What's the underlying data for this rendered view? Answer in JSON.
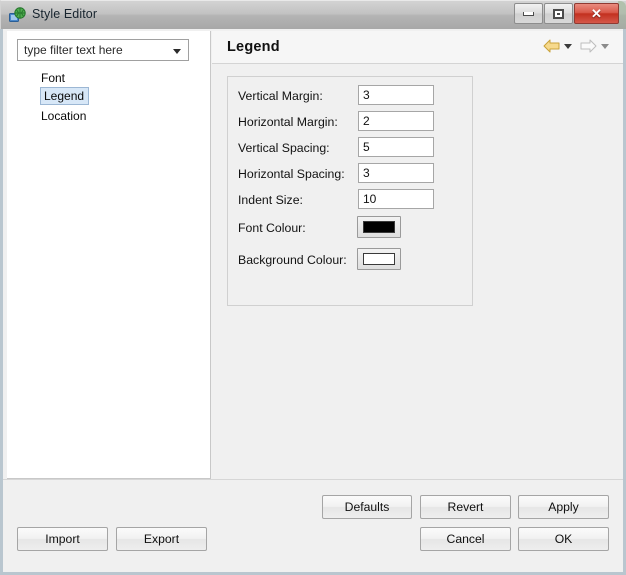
{
  "window": {
    "title": "Style Editor",
    "icon": "network-globe-icon",
    "controls": {
      "minimize": "Minimize",
      "maximize": "Maximize",
      "close": "Close"
    }
  },
  "sidebar": {
    "filter": {
      "value": "type filter text here",
      "placeholder": "type filter text here"
    },
    "tree_items": [
      {
        "label": "Font",
        "selected": false
      },
      {
        "label": "Legend",
        "selected": true
      },
      {
        "label": "Location",
        "selected": false
      }
    ]
  },
  "pane": {
    "title": "Legend",
    "nav": {
      "back_label": "Back",
      "back_enabled": true,
      "forward_label": "Forward",
      "forward_enabled": false,
      "back_menu_label": "Back history",
      "forward_menu_label": "Forward history"
    },
    "fields": [
      {
        "label": "Vertical Margin:",
        "value": "3"
      },
      {
        "label": "Horizontal Margin:",
        "value": "2"
      },
      {
        "label": "Vertical Spacing:",
        "value": "5"
      },
      {
        "label": "Horizontal Spacing:",
        "value": "3"
      },
      {
        "label": "Indent Size:",
        "value": "10"
      }
    ],
    "colours": [
      {
        "label": "Font Colour:",
        "value": "#000000"
      },
      {
        "label": "Background Colour:",
        "value": "#ffffff"
      }
    ]
  },
  "buttons": {
    "import": "Import",
    "export": "Export",
    "defaults": "Defaults",
    "revert": "Revert",
    "apply": "Apply",
    "cancel": "Cancel",
    "ok": "OK"
  },
  "colors": {
    "selection": "#d7e7f7",
    "selection_border": "#9cb7d4",
    "close_button": "#c3301f",
    "nav_back_arrow": "#f5d37a",
    "nav_forward_arrow": "#d8d8d8",
    "panel_bg": "#f0f0f0",
    "tree_bg": "#ffffff"
  }
}
